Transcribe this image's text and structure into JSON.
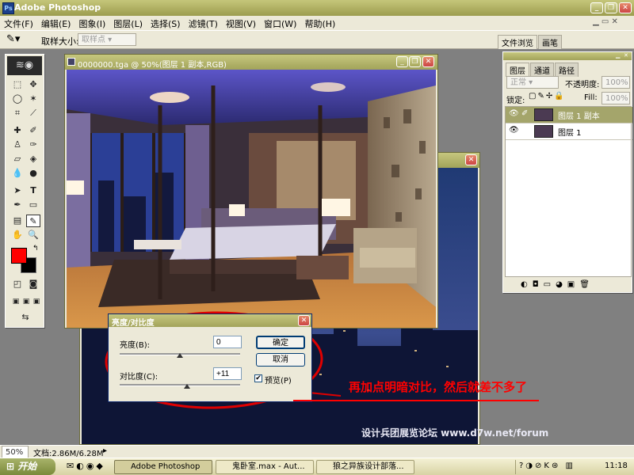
{
  "window": {
    "title": "Adobe Photoshop"
  },
  "menu": [
    "文件(F)",
    "编辑(E)",
    "图象(I)",
    "图层(L)",
    "选择(S)",
    "滤镜(T)",
    "视图(V)",
    "窗口(W)",
    "帮助(H)"
  ],
  "options": {
    "sample_label": "取样大小:",
    "sample_value": "取样点",
    "palette_tabs": [
      "文件浏览",
      "画笔"
    ]
  },
  "doc": {
    "title": "0000000.tga @ 50%(图层 1 副本,RGB)"
  },
  "layers_panel": {
    "tabs": [
      "图层",
      "通道",
      "路径"
    ],
    "blend_mode": "正常",
    "opacity_label": "不透明度:",
    "opacity_value": "100%",
    "lock_label": "锁定:",
    "fill_label": "Fill:",
    "fill_value": "100%",
    "layers": [
      {
        "name": "图层 1 副本"
      },
      {
        "name": "图层 1"
      }
    ]
  },
  "dialog": {
    "title": "亮度/对比度",
    "brightness_label": "亮度(B):",
    "brightness_value": "0",
    "contrast_label": "对比度(C):",
    "contrast_value": "+11",
    "ok_label": "确定",
    "cancel_label": "取消",
    "preview_label": "预览(P)",
    "preview_checked": true
  },
  "annotation": {
    "text": "再加点明暗对比，然后就差不多了",
    "color": "#ff0000"
  },
  "watermark": "设计兵团展览论坛 www.d7w.net/forum",
  "status": {
    "zoom": "50%",
    "doc_size": "文档:2.86M/6.28M"
  },
  "taskbar": {
    "start_label": "开始",
    "tasks": [
      {
        "label": "Adobe Photoshop",
        "active": true
      },
      {
        "label": "鬼卧室.max - Aut...",
        "active": false
      },
      {
        "label": "狼之异族设计部落...",
        "active": false
      }
    ],
    "clock": "11:18"
  },
  "colors": {
    "foreground": "#ff0000",
    "background": "#000000",
    "titlebar": "#a7a85e",
    "annotation_ring": "#e00000"
  }
}
